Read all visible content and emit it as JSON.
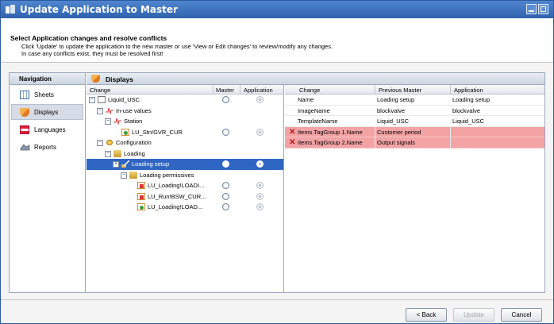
{
  "window": {
    "title": "Update Application to Master"
  },
  "header": {
    "title": "Select Application changes and resolve conflicts",
    "line1": "Click 'Update' to update the application to the new master or use 'View or Edit changes' to review/modify any changes.",
    "line2": "In case any conflicts exist, they must be resolved first!"
  },
  "navigation": {
    "title": "Navigation",
    "items": [
      {
        "label": "Sheets",
        "icon": "sheets-icon",
        "selected": false
      },
      {
        "label": "Displays",
        "icon": "displays-icon",
        "selected": true
      },
      {
        "label": "Languages",
        "icon": "languages-icon",
        "selected": false
      },
      {
        "label": "Reports",
        "icon": "reports-icon",
        "selected": false
      }
    ]
  },
  "displays": {
    "title": "Displays",
    "tree_columns": {
      "change": "Change",
      "master": "Master",
      "application": "Application"
    },
    "tree": [
      {
        "label": "Liquid_USC",
        "expander": "−",
        "icon": "document-icon",
        "master_radio": "unselected",
        "app_radio": "disabled",
        "selected": false
      },
      {
        "label": "In-use values",
        "expander": "−",
        "icon": "trend-icon",
        "selected": false
      },
      {
        "label": "Station",
        "expander": "−",
        "icon": "trend-icon",
        "selected": false
      },
      {
        "label": "LU_Stn!GVR_CUR",
        "expander": "",
        "icon": "variable-icon",
        "master_radio": "unselected",
        "app_radio": "disabled",
        "selected": false
      },
      {
        "label": "Configuration",
        "expander": "−",
        "icon": "gear-icon",
        "selected": false
      },
      {
        "label": "Loading",
        "expander": "−",
        "icon": "folder-icon",
        "selected": false
      },
      {
        "label": "Loading setup",
        "expander": "+",
        "icon": "pencil-icon",
        "master_radio": "unselected",
        "app_radio": "disabled",
        "selected": true
      },
      {
        "label": "Loading permissives",
        "expander": "−",
        "icon": "folder-icon",
        "selected": false
      },
      {
        "label": "LU_Loading!LOADI...",
        "expander": "",
        "icon": "variable-icon",
        "master_radio": "unselected",
        "app_radio": "disabled",
        "selected": false
      },
      {
        "label": "LU_Run!BSW_CUR...",
        "expander": "",
        "icon": "variable-icon",
        "master_radio": "unselected",
        "app_radio": "disabled",
        "selected": false
      },
      {
        "label": "LU_Loading!LOAD...",
        "expander": "",
        "icon": "variable-icon",
        "master_radio": "unselected",
        "app_radio": "disabled",
        "selected": false
      }
    ],
    "change_columns": {
      "change": "Change",
      "previous_master": "Previous Master",
      "application": "Application"
    },
    "changes": [
      {
        "change": "Name",
        "previous_master": "Loading setup",
        "application": "Loading setup",
        "conflict": false
      },
      {
        "change": "ImageName",
        "previous_master": "blockvalve",
        "application": "blockvalve",
        "conflict": false
      },
      {
        "change": "TemplateName",
        "previous_master": "Liquid_USC",
        "application": "Liquid_USC",
        "conflict": false
      },
      {
        "change": "Items.TagGroup 1.Name",
        "previous_master": "Customer period",
        "application": "",
        "conflict": true
      },
      {
        "change": "Items.TagGroup 2.Name",
        "previous_master": "Output signals",
        "application": "",
        "conflict": true
      }
    ]
  },
  "buttons": {
    "back": "< Back",
    "update": "Update",
    "cancel": "Cancel"
  },
  "colors": {
    "title_bar": "#2f62ad",
    "selection": "#2f66c3",
    "conflict_row": "#f4a3a5",
    "conflict_icon": "#c41818"
  }
}
